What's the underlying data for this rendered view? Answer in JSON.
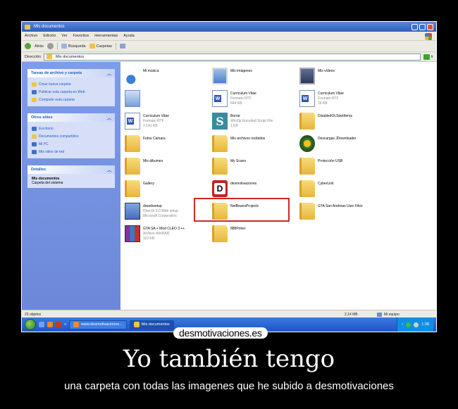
{
  "window": {
    "title": "Mis documentos",
    "menu": [
      "Archivo",
      "Edición",
      "Ver",
      "Favoritos",
      "Herramientas",
      "Ayuda"
    ],
    "toolbar": {
      "back": "Atrás",
      "search": "Búsqueda",
      "folders": "Carpetas"
    },
    "address_label": "Dirección",
    "address_value": "Mis documentos",
    "go_label": "Ir"
  },
  "sidebar": {
    "tasks": {
      "title": "Tareas de archivo y carpeta",
      "items": [
        "Crear nueva carpeta",
        "Publicar esta carpeta en Web",
        "Compartir esta carpeta"
      ]
    },
    "places": {
      "title": "Otros sitios",
      "items": [
        "Escritorio",
        "Documentos compartidos",
        "Mi PC",
        "Mis sitios de red"
      ]
    },
    "details": {
      "title": "Detalles",
      "name": "Mis documentos",
      "desc": "Carpeta del sistema"
    }
  },
  "files": [
    {
      "name": "Mi música",
      "sub1": "",
      "sub2": "",
      "icon": "music-icon"
    },
    {
      "name": "Mis imágenes",
      "sub1": "",
      "sub2": "",
      "icon": "pictures-icon"
    },
    {
      "name": "Mis vídeos",
      "sub1": "",
      "sub2": "",
      "icon": "videos-icon"
    },
    {
      "name": "",
      "sub1": "",
      "sub2": "",
      "icon": "computer-icon"
    },
    {
      "name": "Curriculum Vitae",
      "sub1": "Formato RTF",
      "sub2": "644 KB",
      "icon": "word-document-icon"
    },
    {
      "name": "Curriculum Vitae",
      "sub1": "Formato RTF",
      "sub2": "16 KB",
      "icon": "word-document-icon"
    },
    {
      "name": "Curriculum Vitae",
      "sub1": "Formato RTF",
      "sub2": "2.141 KB",
      "icon": "word-document-icon"
    },
    {
      "name": "Borrar",
      "sub1": "WinZip Encoded Script File",
      "sub2": "1 KB",
      "icon": "script-icon"
    },
    {
      "name": "DisabledOLStartItems",
      "sub1": "",
      "sub2": "",
      "icon": "folder-icon"
    },
    {
      "name": "Fotos Camara",
      "sub1": "",
      "sub2": "",
      "icon": "folder-icon"
    },
    {
      "name": "Mis archivos recibidos",
      "sub1": "",
      "sub2": "",
      "icon": "folder-icon"
    },
    {
      "name": "Descargas JDownloader",
      "sub1": "",
      "sub2": "",
      "icon": "jdownloader-icon"
    },
    {
      "name": "Mis álbumes",
      "sub1": "",
      "sub2": "",
      "icon": "folder-icon"
    },
    {
      "name": "My Scans",
      "sub1": "",
      "sub2": "",
      "icon": "folder-icon"
    },
    {
      "name": "Protección USB",
      "sub1": "",
      "sub2": "",
      "icon": "folder-icon"
    },
    {
      "name": "Gallery",
      "sub1": "",
      "sub2": "",
      "icon": "folder-icon"
    },
    {
      "name": "desmotivaciones",
      "sub1": "",
      "sub2": "",
      "icon": "desmotivaciones-folder-icon"
    },
    {
      "name": "CyberLink",
      "sub1": "",
      "sub2": "",
      "icon": "folder-icon"
    },
    {
      "name": "dxwebsetup",
      "sub1": "DirectX 9.0 Web setup",
      "sub2": "Microsoft Corporation",
      "icon": "setup-icon"
    },
    {
      "name": "NetBeansProjects",
      "sub1": "",
      "sub2": "",
      "icon": "folder-icon"
    },
    {
      "name": "GTA San Andreas User Files",
      "sub1": "",
      "sub2": "",
      "icon": "folder-icon"
    },
    {
      "name": "GTA SA + Mod CLEO 3 ++",
      "sub1": "Archivo WinRAR",
      "sub2": "110 KB",
      "icon": "winrar-icon"
    },
    {
      "name": "888Poker",
      "sub1": "",
      "sub2": "",
      "icon": "folder-icon"
    }
  ],
  "status": {
    "objects": "23 objetos",
    "size": "2,14 MB",
    "location": "Mi equipo"
  },
  "taskbar": {
    "task1": "www.desmotivaciones...",
    "task2": "Mis documentos",
    "clock": "1:38"
  },
  "poster": {
    "watermark": "desmotivaciones.es",
    "title": "Yo también tengo",
    "subtitle": "una carpeta con todas las imagenes que he subido a desmotivaciones"
  }
}
